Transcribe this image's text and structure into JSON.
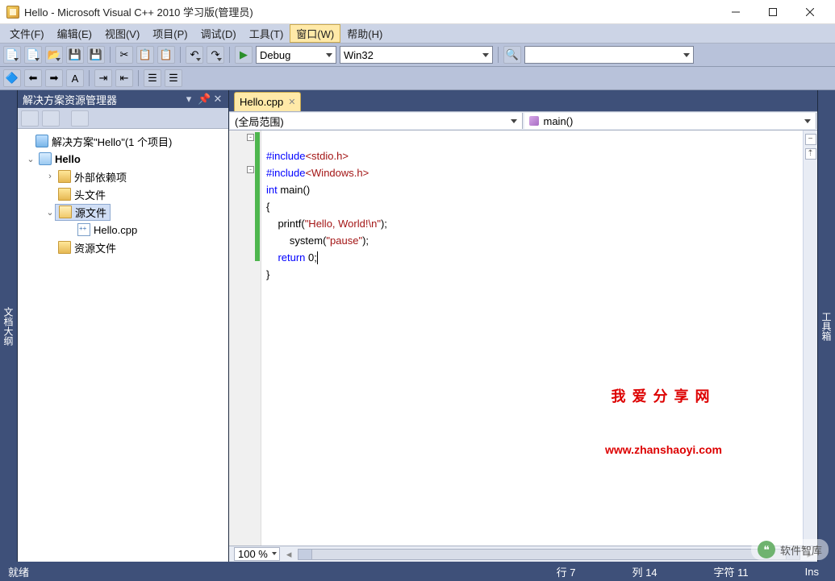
{
  "window": {
    "title": "Hello - Microsoft Visual C++ 2010 学习版(管理员)"
  },
  "menu": {
    "items": [
      "文件(F)",
      "编辑(E)",
      "视图(V)",
      "项目(P)",
      "调试(D)",
      "工具(T)",
      "窗口(W)",
      "帮助(H)"
    ],
    "active_index": 6
  },
  "toolbar": {
    "config": "Debug",
    "platform": "Win32"
  },
  "side_tabs": {
    "left": "文档大纲",
    "right": "工具箱"
  },
  "solution_explorer": {
    "title": "解决方案资源管理器",
    "root": "解决方案\"Hello\"(1 个项目)",
    "project": "Hello",
    "folders": {
      "external": "外部依赖项",
      "headers": "头文件",
      "sources": "源文件",
      "resources": "资源文件"
    },
    "file": "Hello.cpp"
  },
  "editor": {
    "tab": "Hello.cpp",
    "scope_left": "(全局范围)",
    "scope_right": "main()",
    "zoom": "100 %",
    "code": {
      "l1_pp": "#include",
      "l1_inc": "<stdio.h>",
      "l2_pp": "#include",
      "l2_inc": "<Windows.h>",
      "l3_kw": "int",
      "l3_rest": " main()",
      "l4": "{",
      "l5_a": "    printf(",
      "l5_s": "\"Hello, World!\\n\"",
      "l5_b": ");",
      "l6_a": "        system(",
      "l6_s": "\"pause\"",
      "l6_b": ");",
      "l7_kw": "    return",
      "l7_rest": " 0;",
      "l8": "}"
    }
  },
  "watermark": {
    "line1": "我爱分享网",
    "line2": "www.zhanshaoyi.com"
  },
  "statusbar": {
    "ready": "就绪",
    "line": "行 7",
    "col": "列 14",
    "char": "字符 11",
    "ins": "Ins"
  },
  "badge": {
    "text": "软件智库"
  }
}
